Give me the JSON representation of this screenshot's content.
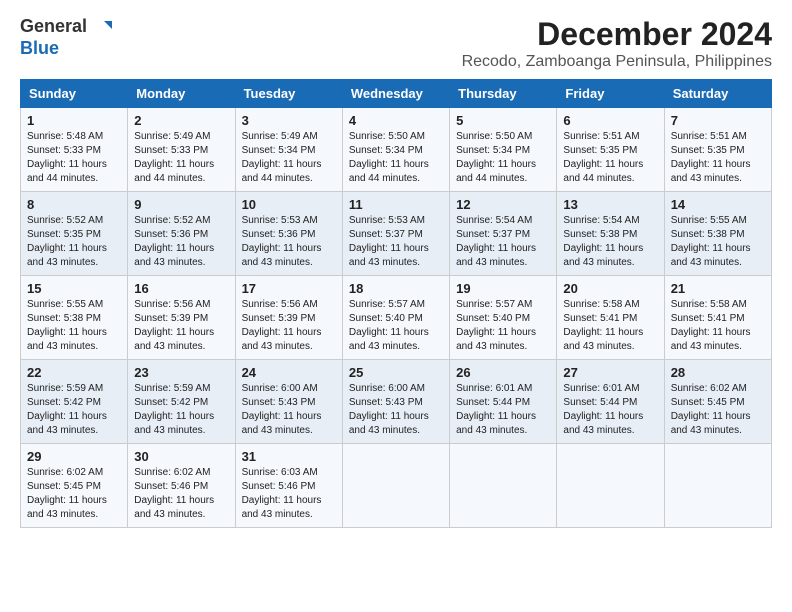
{
  "logo": {
    "line1": "General",
    "line2": "Blue"
  },
  "title": "December 2024",
  "subtitle": "Recodo, Zamboanga Peninsula, Philippines",
  "days_of_week": [
    "Sunday",
    "Monday",
    "Tuesday",
    "Wednesday",
    "Thursday",
    "Friday",
    "Saturday"
  ],
  "weeks": [
    [
      {
        "day": "1",
        "sunrise": "5:48 AM",
        "sunset": "5:33 PM",
        "daylight": "11 hours and 44 minutes."
      },
      {
        "day": "2",
        "sunrise": "5:49 AM",
        "sunset": "5:33 PM",
        "daylight": "11 hours and 44 minutes."
      },
      {
        "day": "3",
        "sunrise": "5:49 AM",
        "sunset": "5:34 PM",
        "daylight": "11 hours and 44 minutes."
      },
      {
        "day": "4",
        "sunrise": "5:50 AM",
        "sunset": "5:34 PM",
        "daylight": "11 hours and 44 minutes."
      },
      {
        "day": "5",
        "sunrise": "5:50 AM",
        "sunset": "5:34 PM",
        "daylight": "11 hours and 44 minutes."
      },
      {
        "day": "6",
        "sunrise": "5:51 AM",
        "sunset": "5:35 PM",
        "daylight": "11 hours and 44 minutes."
      },
      {
        "day": "7",
        "sunrise": "5:51 AM",
        "sunset": "5:35 PM",
        "daylight": "11 hours and 43 minutes."
      }
    ],
    [
      {
        "day": "8",
        "sunrise": "5:52 AM",
        "sunset": "5:35 PM",
        "daylight": "11 hours and 43 minutes."
      },
      {
        "day": "9",
        "sunrise": "5:52 AM",
        "sunset": "5:36 PM",
        "daylight": "11 hours and 43 minutes."
      },
      {
        "day": "10",
        "sunrise": "5:53 AM",
        "sunset": "5:36 PM",
        "daylight": "11 hours and 43 minutes."
      },
      {
        "day": "11",
        "sunrise": "5:53 AM",
        "sunset": "5:37 PM",
        "daylight": "11 hours and 43 minutes."
      },
      {
        "day": "12",
        "sunrise": "5:54 AM",
        "sunset": "5:37 PM",
        "daylight": "11 hours and 43 minutes."
      },
      {
        "day": "13",
        "sunrise": "5:54 AM",
        "sunset": "5:38 PM",
        "daylight": "11 hours and 43 minutes."
      },
      {
        "day": "14",
        "sunrise": "5:55 AM",
        "sunset": "5:38 PM",
        "daylight": "11 hours and 43 minutes."
      }
    ],
    [
      {
        "day": "15",
        "sunrise": "5:55 AM",
        "sunset": "5:38 PM",
        "daylight": "11 hours and 43 minutes."
      },
      {
        "day": "16",
        "sunrise": "5:56 AM",
        "sunset": "5:39 PM",
        "daylight": "11 hours and 43 minutes."
      },
      {
        "day": "17",
        "sunrise": "5:56 AM",
        "sunset": "5:39 PM",
        "daylight": "11 hours and 43 minutes."
      },
      {
        "day": "18",
        "sunrise": "5:57 AM",
        "sunset": "5:40 PM",
        "daylight": "11 hours and 43 minutes."
      },
      {
        "day": "19",
        "sunrise": "5:57 AM",
        "sunset": "5:40 PM",
        "daylight": "11 hours and 43 minutes."
      },
      {
        "day": "20",
        "sunrise": "5:58 AM",
        "sunset": "5:41 PM",
        "daylight": "11 hours and 43 minutes."
      },
      {
        "day": "21",
        "sunrise": "5:58 AM",
        "sunset": "5:41 PM",
        "daylight": "11 hours and 43 minutes."
      }
    ],
    [
      {
        "day": "22",
        "sunrise": "5:59 AM",
        "sunset": "5:42 PM",
        "daylight": "11 hours and 43 minutes."
      },
      {
        "day": "23",
        "sunrise": "5:59 AM",
        "sunset": "5:42 PM",
        "daylight": "11 hours and 43 minutes."
      },
      {
        "day": "24",
        "sunrise": "6:00 AM",
        "sunset": "5:43 PM",
        "daylight": "11 hours and 43 minutes."
      },
      {
        "day": "25",
        "sunrise": "6:00 AM",
        "sunset": "5:43 PM",
        "daylight": "11 hours and 43 minutes."
      },
      {
        "day": "26",
        "sunrise": "6:01 AM",
        "sunset": "5:44 PM",
        "daylight": "11 hours and 43 minutes."
      },
      {
        "day": "27",
        "sunrise": "6:01 AM",
        "sunset": "5:44 PM",
        "daylight": "11 hours and 43 minutes."
      },
      {
        "day": "28",
        "sunrise": "6:02 AM",
        "sunset": "5:45 PM",
        "daylight": "11 hours and 43 minutes."
      }
    ],
    [
      {
        "day": "29",
        "sunrise": "6:02 AM",
        "sunset": "5:45 PM",
        "daylight": "11 hours and 43 minutes."
      },
      {
        "day": "30",
        "sunrise": "6:02 AM",
        "sunset": "5:46 PM",
        "daylight": "11 hours and 43 minutes."
      },
      {
        "day": "31",
        "sunrise": "6:03 AM",
        "sunset": "5:46 PM",
        "daylight": "11 hours and 43 minutes."
      },
      null,
      null,
      null,
      null
    ]
  ]
}
